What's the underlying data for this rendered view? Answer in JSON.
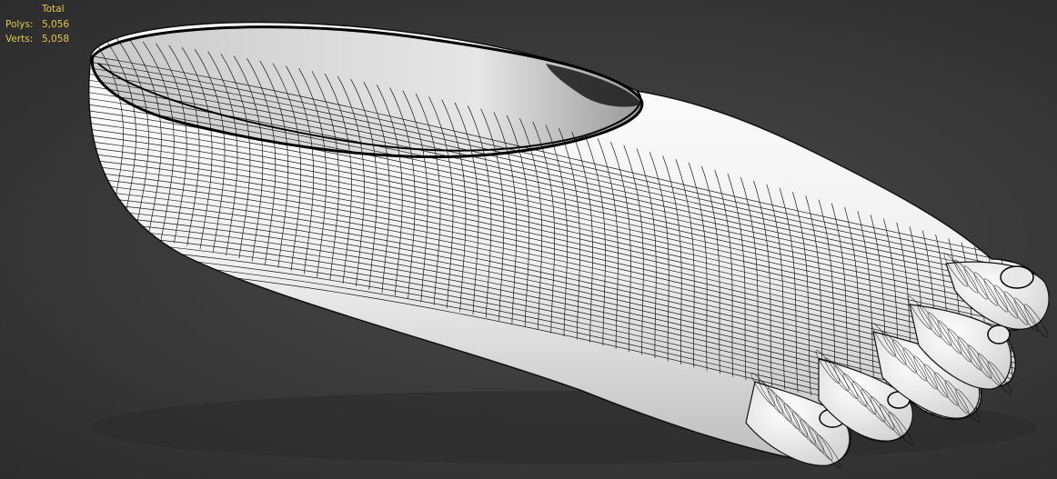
{
  "viewport": {
    "name": "3D viewport",
    "background": "#3a3a3a",
    "stats": {
      "header": "Total",
      "polys_label": "Polys:",
      "polys_value": "5,056",
      "verts_label": "Verts:",
      "verts_value": "5,058",
      "text_color": "#e5c84d"
    }
  },
  "model": {
    "subject": "foot mesh with wireframe overlay",
    "shading": "white clay with black edged faces",
    "wire_color": "#000000",
    "surface_color": "#f2f2f2"
  }
}
